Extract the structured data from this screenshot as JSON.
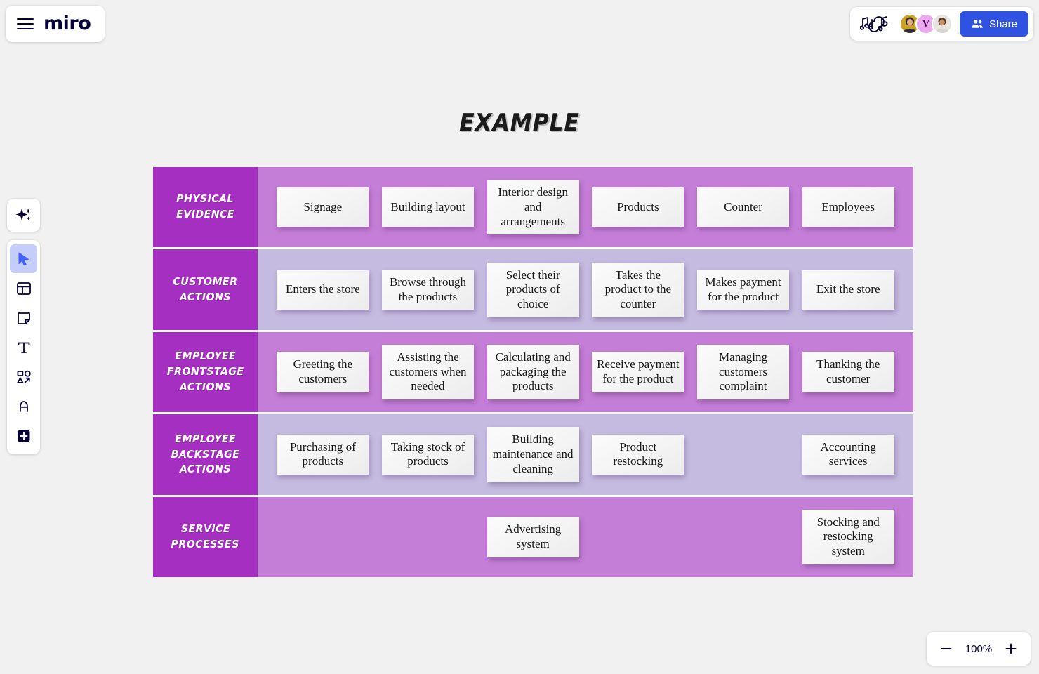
{
  "app": {
    "name": "miro",
    "menu_icon": "hamburger-menu-icon"
  },
  "topbar": {
    "music_icon": "music-notes-icon",
    "share_label": "Share",
    "share_icon": "people-icon",
    "share_color": "#2f52e0",
    "collaborators": [
      {
        "name": "collaborator-1",
        "type": "photo"
      },
      {
        "name": "collaborator-2",
        "type": "initial",
        "initial": "V",
        "color": "#eda9f0"
      },
      {
        "name": "collaborator-3",
        "type": "photo"
      }
    ]
  },
  "toolbar": {
    "items": [
      {
        "icon": "ai-sparkle-icon",
        "name": "ai-tool",
        "active": false
      },
      {
        "icon": "cursor-select-icon",
        "name": "select-tool",
        "active": true
      },
      {
        "icon": "templates-icon",
        "name": "templates-tool",
        "active": false
      },
      {
        "icon": "sticky-note-icon",
        "name": "sticky-note-tool",
        "active": false
      },
      {
        "icon": "text-icon",
        "name": "text-tool",
        "active": false
      },
      {
        "icon": "shapes-icon",
        "name": "shapes-tool",
        "active": false
      },
      {
        "icon": "pen-icon",
        "name": "pen-tool",
        "active": false
      },
      {
        "icon": "plus-icon",
        "name": "more-apps-tool",
        "active": false
      }
    ]
  },
  "board": {
    "frame_title": "EXAMPLE",
    "label_color": "#a52fc0",
    "row_dark_color": "#c57ed8",
    "row_light_color": "#c5bbe1",
    "rows": [
      {
        "label_lines": [
          "PHYSICAL",
          "EVIDENCE"
        ],
        "tone": "dark",
        "notes": [
          "Signage",
          "Building layout",
          "Interior design and arrangements",
          "Products",
          "Counter",
          "Employees"
        ]
      },
      {
        "label_lines": [
          "CUSTOMER",
          "ACTIONS"
        ],
        "tone": "light",
        "notes": [
          "Enters the store",
          "Browse through the products",
          "Select their products of choice",
          "Takes the product to the counter",
          "Makes payment for the product",
          "Exit the store"
        ]
      },
      {
        "label_lines": [
          "EMPLOYEE",
          "FRONTSTAGE",
          "ACTIONS"
        ],
        "tone": "dark",
        "notes": [
          "Greeting the customers",
          "Assisting the customers when needed",
          "Calculating and packaging the products",
          "Receive payment for the product",
          "Managing customers complaint",
          "Thanking the customer"
        ]
      },
      {
        "label_lines": [
          "EMPLOYEE",
          "BACKSTAGE",
          "ACTIONS"
        ],
        "tone": "light",
        "notes": [
          "Purchasing of products",
          "Taking stock of products",
          "Building maintenance and cleaning",
          "Product restocking",
          "",
          "Accounting services"
        ]
      },
      {
        "label_lines": [
          "SERVICE",
          "PROCESSES"
        ],
        "tone": "dark",
        "notes": [
          "",
          "",
          "Advertising system",
          "",
          "",
          "Stocking and restocking system"
        ]
      }
    ]
  },
  "zoom": {
    "level": "100%",
    "minus_label": "−",
    "plus_label": "+"
  }
}
